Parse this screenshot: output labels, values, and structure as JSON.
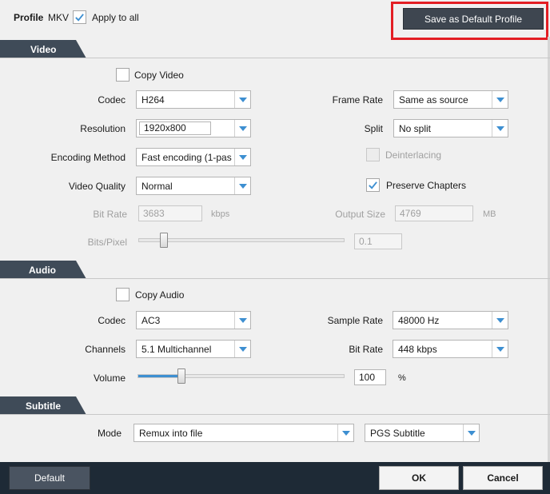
{
  "header": {
    "profile_label": "Profile",
    "profile_format": "MKV",
    "apply_to_all_label": "Apply to all",
    "apply_to_all_checked": true,
    "save_default_label": "Save as Default Profile"
  },
  "video": {
    "section_title": "Video",
    "copy_video_label": "Copy Video",
    "codec_label": "Codec",
    "codec_value": "H264",
    "resolution_label": "Resolution",
    "resolution_value": "1920x800",
    "encoding_method_label": "Encoding Method",
    "encoding_method_value": "Fast encoding (1-pas",
    "video_quality_label": "Video Quality",
    "video_quality_value": "Normal",
    "bit_rate_label": "Bit Rate",
    "bit_rate_value": "3683",
    "bit_rate_unit": "kbps",
    "bits_pixel_label": "Bits/Pixel",
    "bits_pixel_value": "0.1",
    "frame_rate_label": "Frame Rate",
    "frame_rate_value": "Same as source",
    "split_label": "Split",
    "split_value": "No split",
    "deinterlacing_label": "Deinterlacing",
    "preserve_chapters_label": "Preserve Chapters",
    "preserve_chapters_checked": true,
    "output_size_label": "Output Size",
    "output_size_value": "4769",
    "output_size_unit": "MB"
  },
  "audio": {
    "section_title": "Audio",
    "copy_audio_label": "Copy Audio",
    "codec_label": "Codec",
    "codec_value": "AC3",
    "channels_label": "Channels",
    "channels_value": "5.1 Multichannel",
    "volume_label": "Volume",
    "volume_value": "100",
    "volume_unit": "%",
    "sample_rate_label": "Sample Rate",
    "sample_rate_value": "48000 Hz",
    "bit_rate_label": "Bit Rate",
    "bit_rate_value": "448 kbps"
  },
  "subtitle": {
    "section_title": "Subtitle",
    "mode_label": "Mode",
    "mode_value": "Remux into file",
    "format_value": "PGS Subtitle"
  },
  "footer": {
    "default_label": "Default",
    "ok_label": "OK",
    "cancel_label": "Cancel"
  },
  "colors": {
    "header_dark": "#3f4b58",
    "footer_dark": "#1e2a36",
    "highlight_red": "#e31e24",
    "accent_blue": "#3d8fd1"
  },
  "icons": {
    "check": "check-icon",
    "dropdown": "chevron-down-icon"
  }
}
